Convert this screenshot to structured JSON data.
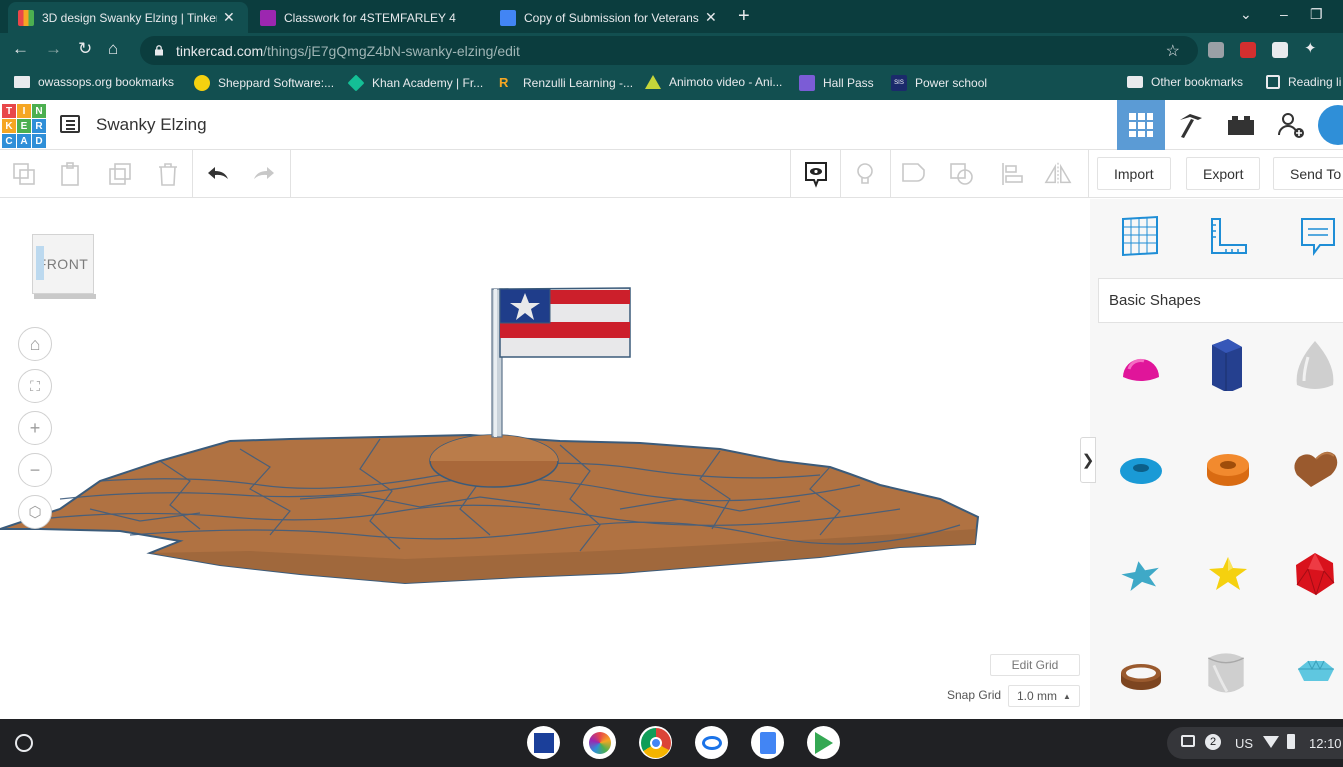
{
  "browser": {
    "tabs": [
      {
        "title": "3D design Swanky Elzing | Tinker",
        "active": true
      },
      {
        "title": "Classwork for 4STEMFARLEY 4",
        "active": false
      },
      {
        "title": "Copy of Submission for Veterans",
        "active": false
      }
    ],
    "url_host": "tinkercad.com",
    "url_path": "/things/jE7gQmgZ4bN-swanky-elzing/edit",
    "bookmarks": [
      "owassops.org bookmarks",
      "Sheppard Software:...",
      "Khan Academy | Fr...",
      "Renzulli Learning -...",
      "Animoto video - Ani...",
      "Hall Pass",
      "Power school"
    ],
    "other_bookmarks": "Other bookmarks",
    "reading_list": "Reading li"
  },
  "app": {
    "logo_letters": [
      "T",
      "I",
      "N",
      "K",
      "E",
      "R",
      "C",
      "A",
      "D"
    ],
    "project_title": "Swanky Elzing",
    "toolbar": {
      "import_label": "Import",
      "export_label": "Export",
      "send_to_label": "Send To"
    },
    "workplane": {
      "viewcube_label": "FRONT",
      "edit_grid_label": "Edit Grid",
      "snap_grid_label": "Snap Grid",
      "snap_grid_value": "1.0 mm",
      "snap_grid_arrow": "▲"
    },
    "panel": {
      "category": "Basic Shapes",
      "shapes": [
        {
          "name": "hemisphere",
          "color": "#e0159a"
        },
        {
          "name": "polygon",
          "color": "#25408f"
        },
        {
          "name": "paraboloid",
          "color": "#cfcfcf"
        },
        {
          "name": "torus",
          "color": "#1a9ad6"
        },
        {
          "name": "tube",
          "color": "#e67a1e"
        },
        {
          "name": "heart",
          "color": "#9a5a2e"
        },
        {
          "name": "star",
          "color": "#3fa9c7"
        },
        {
          "name": "star",
          "color": "#f5d10f"
        },
        {
          "name": "icosahedron",
          "color": "#d9121c"
        },
        {
          "name": "ring",
          "color": "#9a5a2e"
        },
        {
          "name": "round-roof",
          "color": "#cfcfcf"
        },
        {
          "name": "diamond",
          "color": "#5fc7e0"
        }
      ]
    }
  },
  "shelf": {
    "notification_count": "2",
    "locale": "US",
    "time": "12:10"
  }
}
